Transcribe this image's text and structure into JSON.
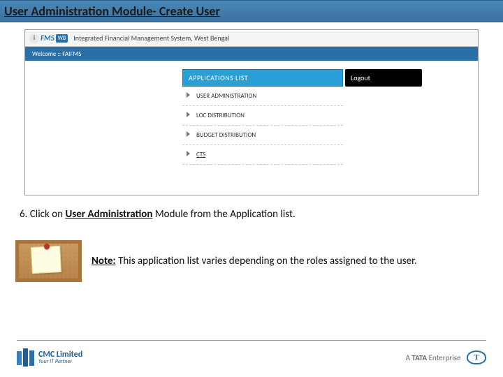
{
  "slide": {
    "title": "User Administration Module- Create User"
  },
  "app": {
    "system_name": "Integrated Financial Management System, West Bengal",
    "logo_fms": "FMS",
    "logo_wb": "WB",
    "welcome_label": "Welcome ::",
    "welcome_user": "FAIFMS",
    "applications_header": "APPLICATIONS LIST",
    "logout_label": "Logout",
    "items": [
      {
        "label": "USER ADMINISTRATION"
      },
      {
        "label": "LOC DISTRIBUTION"
      },
      {
        "label": "BUDGET DISTRIBUTION"
      },
      {
        "label": "CTS"
      }
    ]
  },
  "instruction": {
    "step_no": "6.",
    "prefix": "Click on",
    "bold": "User Administration",
    "suffix": "Module from the Application list."
  },
  "note": {
    "label": "Note:",
    "text": "This application list varies depending on the roles assigned to the user."
  },
  "footer": {
    "cmc_main": "CMC Limited",
    "cmc_sub": "Your IT Partner",
    "tata_prefix": "A ",
    "tata_strong": "TATA",
    "tata_suffix": " Enterprise"
  }
}
